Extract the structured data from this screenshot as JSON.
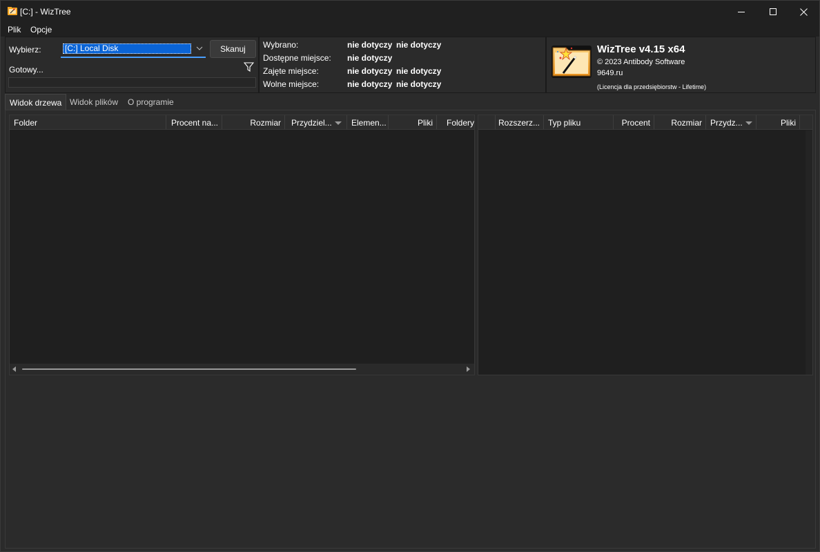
{
  "window": {
    "title": "[C:]  - WizTree",
    "accent_color": "#0a64d6",
    "background_color": "#2b2b2b"
  },
  "menu": [
    "Plik",
    "Opcje"
  ],
  "scan_panel": {
    "select_label": "Wybierz:",
    "selected_drive": "[C:] Local Disk",
    "scan_button": "Skanuj",
    "status": "Gotowy..."
  },
  "disk_info": {
    "rows": [
      {
        "label": "Wybrano:",
        "value1": "nie dotyczy",
        "value2": "nie dotyczy"
      },
      {
        "label": "Dostępne miejsce:",
        "value1": "nie dotyczy",
        "value2": ""
      },
      {
        "label": "Zajęte miejsce:",
        "value1": "nie dotyczy",
        "value2": "nie dotyczy"
      },
      {
        "label": "Wolne miejsce:",
        "value1": "nie dotyczy",
        "value2": "nie dotyczy"
      }
    ]
  },
  "about": {
    "product": "WizTree v4.15 x64",
    "copyright": "© 2023 Antibody Software",
    "site": "9649.ru",
    "license": "(Licencja dla przedsiębiorstw - Lifetime)"
  },
  "tabs": [
    {
      "label": "Widok drzewa",
      "active": true
    },
    {
      "label": "Widok plików",
      "active": false
    },
    {
      "label": "O programie",
      "active": false
    }
  ],
  "tree_table": {
    "columns": [
      "Folder",
      "Procent na...",
      "Rozmiar",
      "Przydziel...",
      "Elemen...",
      "Pliki",
      "Foldery"
    ],
    "sorted_column": "Przydziel...",
    "rows": []
  },
  "ext_table": {
    "columns": [
      "",
      "Rozszerz...",
      "Typ pliku",
      "Procent",
      "Rozmiar",
      "Przydz...",
      "Pliki"
    ],
    "sorted_column": "Przydz...",
    "rows": []
  },
  "icons": [
    "wiztree-app-icon",
    "minimize-icon",
    "maximize-icon",
    "close-icon",
    "chevron-down-icon",
    "filter-icon",
    "wiztree-logo",
    "scroll-left-arrow-icon",
    "scroll-right-arrow-icon"
  ]
}
